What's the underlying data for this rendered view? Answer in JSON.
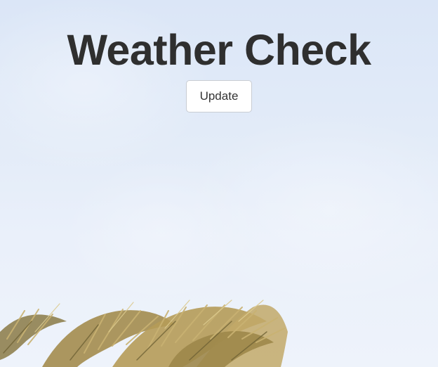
{
  "page": {
    "title": "Weather Check",
    "update_button_label": "Update"
  },
  "colors": {
    "sky_top": "#dbe6f7",
    "sky_bottom": "#eef3fb",
    "title_text": "#2f2f2f",
    "button_bg": "#ffffff",
    "button_border": "#c8ccd2",
    "palm_frond": "#b89a55"
  },
  "background": {
    "image_subject": "sky with palm fronds"
  }
}
